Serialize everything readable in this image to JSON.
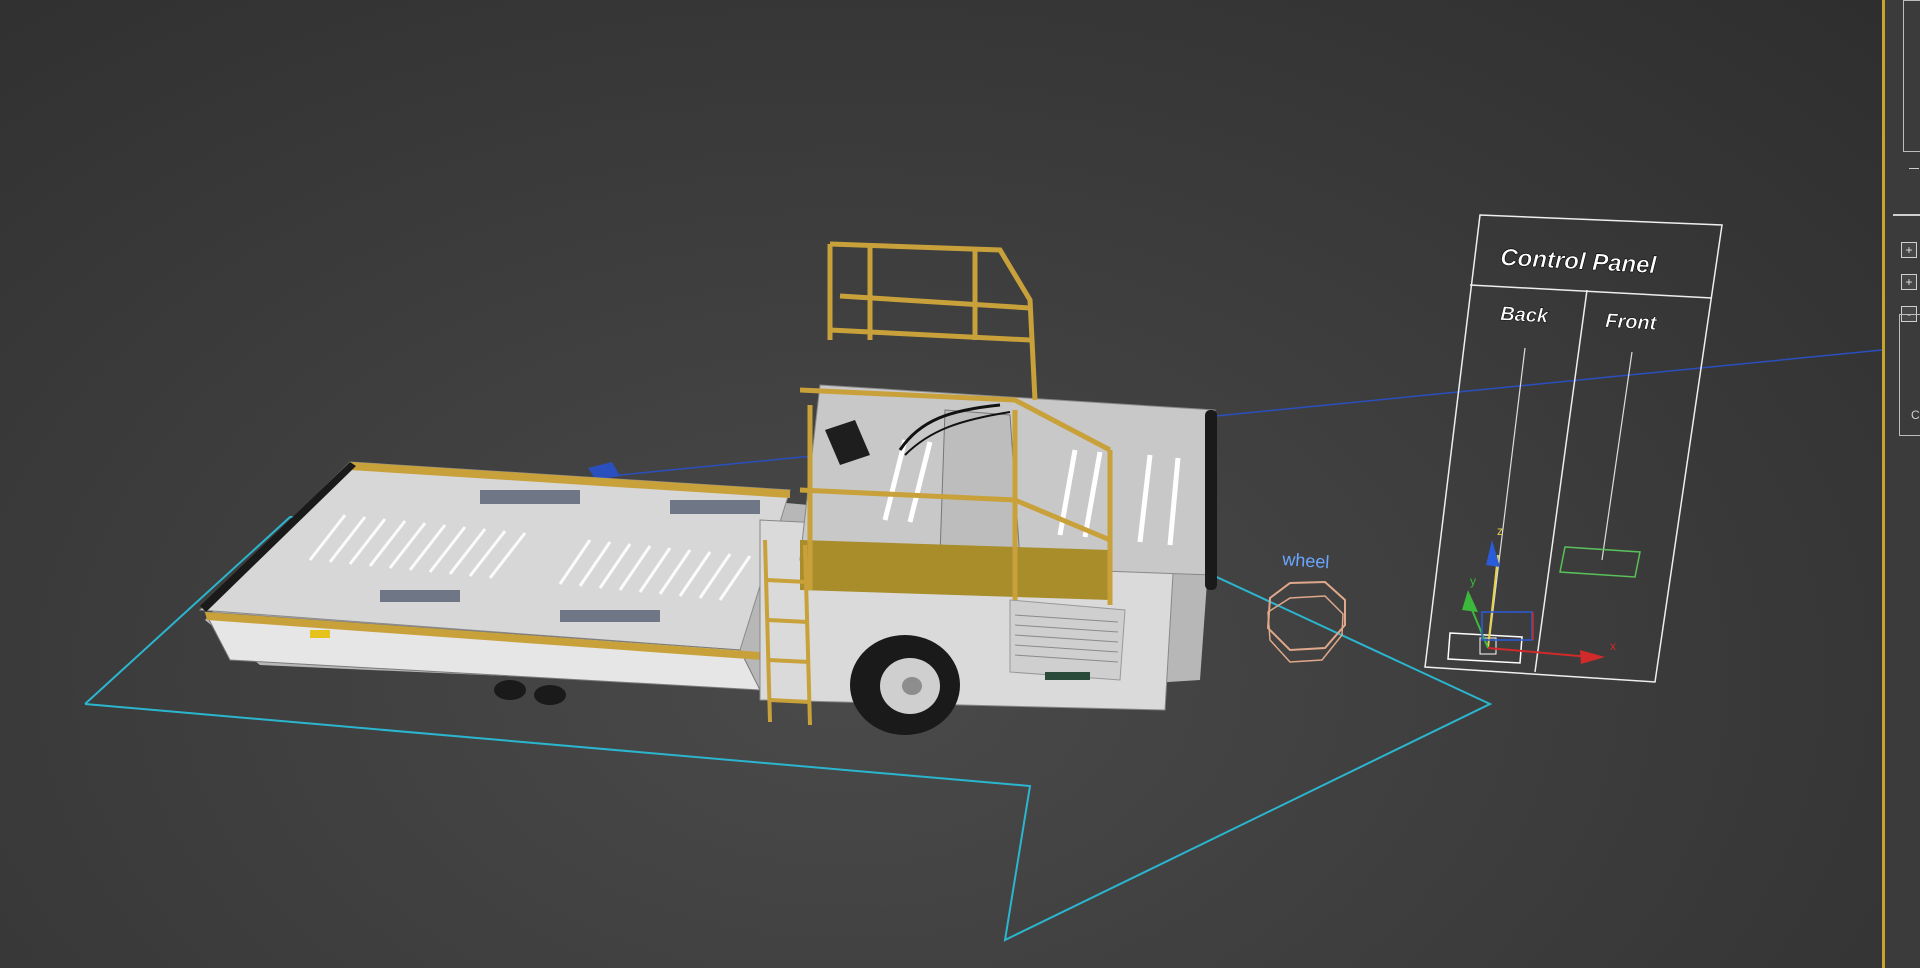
{
  "scene": {
    "control_panel": {
      "title": "Control Panel",
      "back_label": "Back",
      "front_label": "Front"
    },
    "wheel_label": "wheel",
    "axis_labels": {
      "z": "z",
      "y": "y",
      "x": "x"
    }
  },
  "side_panel": {
    "add_button_1": "+",
    "add_button_2": "+",
    "remove_button": "-",
    "small_text": "C"
  },
  "colors": {
    "viewport_bg": "#3f3f3f",
    "border_accent": "#c8a42a",
    "vehicle_yellow": "#c9a13a",
    "vehicle_body": "#d8d8d8",
    "selection_cyan": "#2bb6cf",
    "spline_blue": "#2a4fbf",
    "wheel_helper": "#e0a88a",
    "wheel_text": "#6aa7ff",
    "slider_green": "#5ac15a"
  }
}
